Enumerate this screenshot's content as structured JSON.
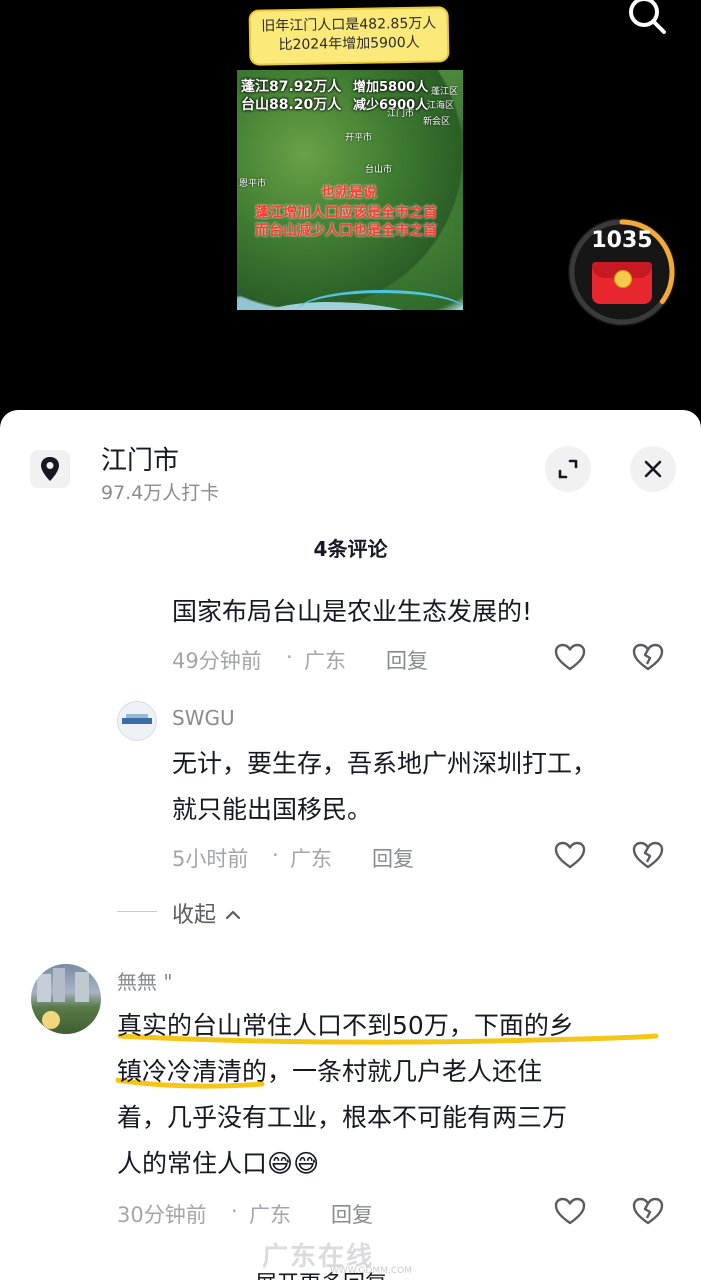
{
  "video": {
    "bubble_line1": "旧年江门人口是482.85万人",
    "bubble_line2": "比2024年增加5900人",
    "map": {
      "pengjiang": "蓬江87.92万人",
      "taishan": "台山88.20万人",
      "increase": "增加5800人",
      "decrease": "减少6900人",
      "jiangmen_label": "江门市",
      "taishan_label": "台山市",
      "enping_label": "恩平市",
      "kaiping_label": "开平市",
      "pengjiang_label": "蓬江区",
      "jianghai_label": "江海区",
      "xinhui_label": "新会区",
      "red_line1": "也就是说",
      "red_line2": "蓬江增加人口应该是全市之首",
      "red_line3": "而台山减少人口也是全市之首"
    },
    "redpacket_count": "1035",
    "redpacket_progress": 0.35
  },
  "header": {
    "location_name": "江门市",
    "checkins": "97.4万人打卡",
    "comment_count": "4条评论"
  },
  "comments": [
    {
      "text": "国家布局台山是农业生态发展的!",
      "time": "49分钟前",
      "region": "广东",
      "reply": "回复"
    },
    {
      "author": "SWGU",
      "text_line1": "无计，要生存，吾系地广州深圳打工，",
      "text_line2": "就只能出国移民。",
      "time": "5小时前",
      "region": "广东",
      "reply": "回复"
    },
    {
      "author": "無無 \"",
      "text_line1": "真实的台山常住人口不到50万，下面的乡",
      "text_line2": "镇冷冷清清的，一条村就几户老人还住",
      "text_line3": "着，几乎没有工业，根本不可能有两三万",
      "text_line4": "人的常住人口😅😅",
      "time": "30分钟前",
      "region": "广东",
      "reply": "回复"
    }
  ],
  "collapse_label": "收起",
  "more_label": "展开更多回复",
  "separator": "·",
  "watermark": "广东在线",
  "watermark_sub": "WWW.GDMM.COM",
  "colors": {
    "panel": "#ffffff",
    "text": "#161823",
    "meta": "#a4a5aa",
    "underline": "#f5c518",
    "redpacket": "#e8262e"
  }
}
